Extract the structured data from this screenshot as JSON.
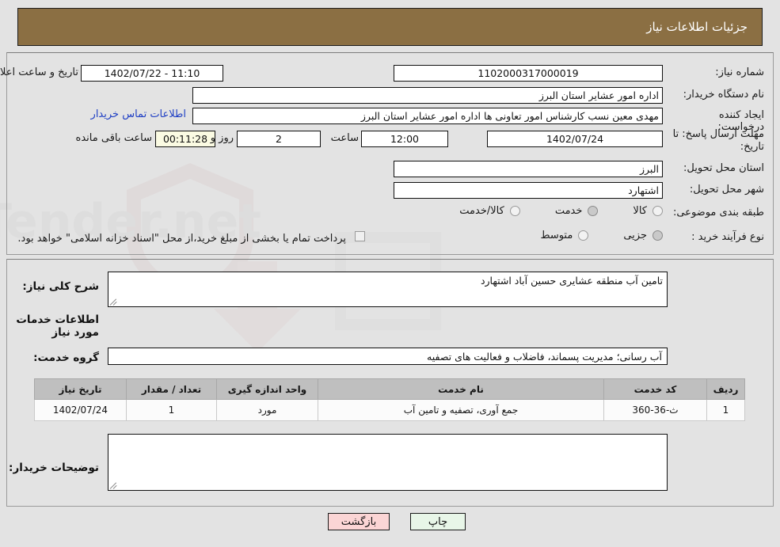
{
  "header": {
    "title": "جزئیات اطلاعات نیاز"
  },
  "top_form": {
    "need_number_label": "شماره نیاز:",
    "need_number_value": "1102000317000019",
    "buyer_org_label": "نام دستگاه خریدار:",
    "buyer_org_value": "اداره امور عشایر استان البرز",
    "creator_label": "ایجاد کننده درخواست:",
    "creator_value": "مهدی معین نسب کارشناس امور تعاونی ها اداره امور عشایر استان البرز",
    "deadline_label": "مهلت ارسال پاسخ: تا تاریخ:",
    "deadline_value": "1402/07/24",
    "hour_label": "ساعت",
    "hour_value": "12:00",
    "days_value": "2",
    "days_label": "روز و",
    "countdown_value": "00:11:28",
    "remaining_label": "ساعت باقی مانده",
    "publish_label": "تاریخ و ساعت اعلان عمومی:",
    "publish_value": "11:10 - 1402/07/22",
    "contact_link": "اطلاعات تماس خریدار",
    "province_label": "استان محل تحویل:",
    "province_value": "البرز",
    "city_label": "شهر محل تحویل:",
    "city_value": "اشتهارد",
    "category_label": "طبقه بندی موضوعی:",
    "category_options": [
      {
        "label": "کالا",
        "selected": false
      },
      {
        "label": "خدمت",
        "selected": true
      },
      {
        "label": "کالا/خدمت",
        "selected": false
      }
    ],
    "process_label": "نوع فرآیند خرید :",
    "process_options": [
      {
        "label": "جزیی",
        "selected": true
      },
      {
        "label": "متوسط",
        "selected": false
      }
    ],
    "treasury_checked": false,
    "treasury_text": "پرداخت تمام یا بخشی از مبلغ خرید،از محل \"اسناد خزانه اسلامی\" خواهد بود."
  },
  "bottom_form": {
    "description_label": "شرح کلی نیاز:",
    "description_value": "تامین آب منطقه عشایری حسین آباد اشتهارد",
    "section_title": "اطلاعات خدمات مورد نیاز",
    "service_group_label": "گروه خدمت:",
    "service_group_value": "آب رسانی؛ مدیریت پسماند، فاضلاب و فعالیت های تصفیه",
    "notes_label": "توضیحات خریدار:",
    "notes_value": ""
  },
  "table": {
    "columns": [
      "ردیف",
      "کد خدمت",
      "نام خدمت",
      "واحد اندازه گیری",
      "تعداد / مقدار",
      "تاریخ نیاز"
    ],
    "rows": [
      {
        "row_no": "1",
        "service_code": "ث-36-360",
        "service_name": "جمع آوری، تصفیه و تامین آب",
        "unit": "مورد",
        "quantity": "1",
        "need_date": "1402/07/24"
      }
    ]
  },
  "footer": {
    "print_label": "چاپ",
    "back_label": "بازگشت"
  },
  "colors": {
    "header_bar": "#8b6f43",
    "page_background": "#e3e3e3",
    "link": "#1f3fc4",
    "table_header": "#bfbfbf",
    "print_button": "#e8f6e8",
    "back_button": "#fbd5d5",
    "countdown_field": "#fbfbe3"
  }
}
